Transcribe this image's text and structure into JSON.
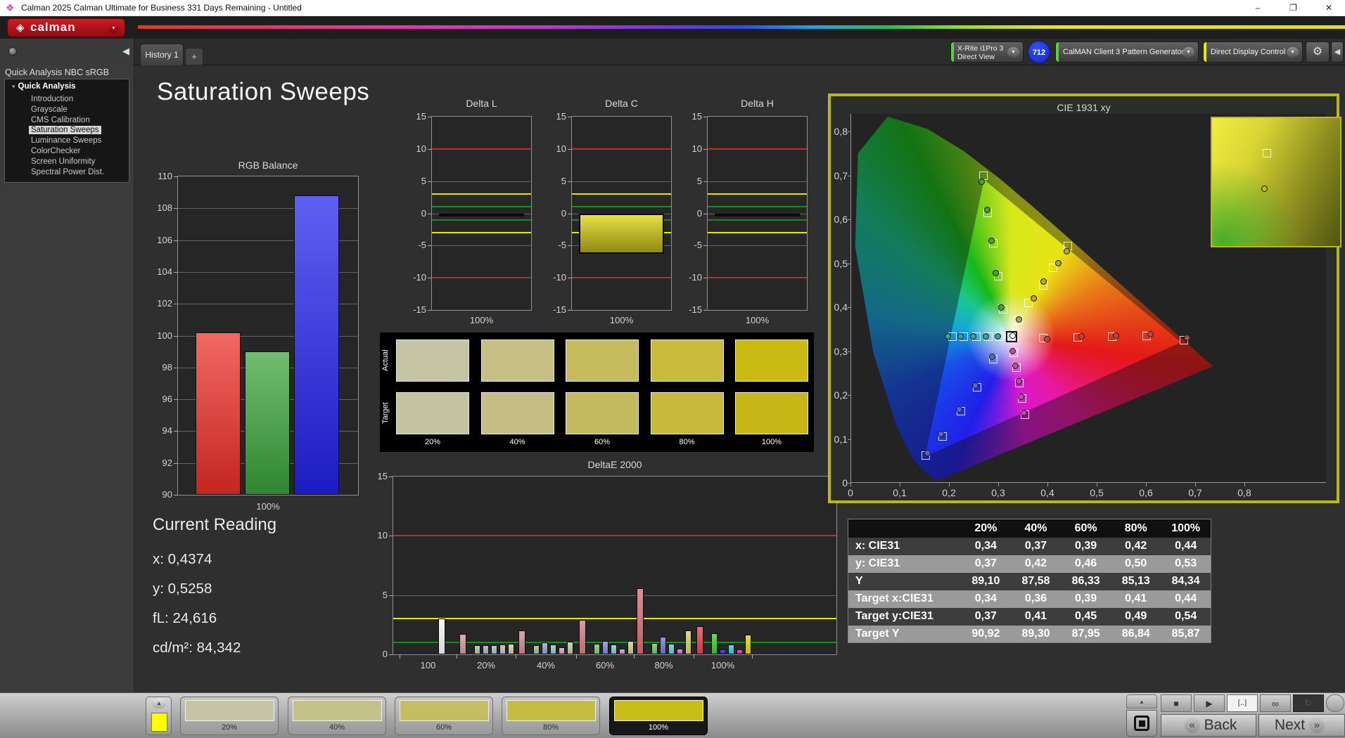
{
  "titlebar": {
    "title": "Calman 2025 Calman Ultimate for Business 331 Days Remaining  - Untitled",
    "minimize": "–",
    "maximize": "❐",
    "close": "✕"
  },
  "appbar": {
    "logo": "calman"
  },
  "icons": {
    "app": "❖",
    "logo_diamond": "◈",
    "dropdown": "▼",
    "collapse_left": "◀",
    "add": "+",
    "gear": "⚙",
    "tree_expand": "▾",
    "up": "▲",
    "play": "▶",
    "stop": "■",
    "pattern_window": "[‥]",
    "infinity": "∞",
    "repeat": "↻",
    "back_chev": "«",
    "next_chev": "»"
  },
  "toolbar": {
    "history_tab": "History 1",
    "meter_line1": "X-Rite i1Pro 3",
    "meter_line2": "Direct View",
    "meter_badge": "712",
    "pattern_source": "CalMAN Client 3 Pattern Generator",
    "display_control": "Direct Display Control"
  },
  "sidebar": {
    "workflow_title": "Quick Analysis NBC sRGB",
    "root": "Quick Analysis",
    "items": [
      "Introduction",
      "Grayscale",
      "CMS Calibration",
      "Saturation Sweeps",
      "Luminance Sweeps",
      "ColorChecker",
      "Screen Uniformity",
      "Spectral Power Dist."
    ],
    "selected_index": 3
  },
  "main": {
    "page_title": "Saturation Sweeps"
  },
  "current_reading": {
    "title": "Current Reading",
    "lines": [
      "x: 0,4374",
      "y: 0,5258",
      "fL: 24,616",
      "cd/m²: 84,342"
    ]
  },
  "chart_data": [
    {
      "id": "rgb_balance",
      "type": "bar",
      "title": "RGB Balance",
      "categories": [
        "Red",
        "Green",
        "Blue"
      ],
      "values": [
        100.2,
        99.0,
        108.8
      ],
      "colors": [
        "#ee2e28",
        "#3aa43a",
        "#2222ee"
      ],
      "ylim": [
        90,
        110
      ],
      "ytick_step": 2,
      "xlabel": "100%"
    },
    {
      "id": "delta_l",
      "type": "bar",
      "title": "Delta L",
      "categories": [
        "100%"
      ],
      "values": [
        -0.5
      ],
      "ylim": [
        -15,
        15
      ],
      "yticks": [
        15,
        10,
        5,
        0,
        -5,
        -10,
        -15
      ],
      "ref_lines": [
        {
          "v": 10,
          "c": "red"
        },
        {
          "v": 3,
          "c": "yellow"
        },
        {
          "v": 1,
          "c": "green"
        },
        {
          "v": -1,
          "c": "green"
        },
        {
          "v": -3,
          "c": "yellow"
        },
        {
          "v": -10,
          "c": "red"
        }
      ],
      "xlabel": "100%"
    },
    {
      "id": "delta_c",
      "type": "bar",
      "title": "Delta C",
      "categories": [
        "100%"
      ],
      "values": [
        -6.3
      ],
      "ylim": [
        -15,
        15
      ],
      "yticks": [
        15,
        10,
        5,
        0,
        -5,
        -10,
        -15
      ],
      "ref_lines": [
        {
          "v": 10,
          "c": "red"
        },
        {
          "v": 3,
          "c": "yellow"
        },
        {
          "v": 1,
          "c": "green"
        },
        {
          "v": -1,
          "c": "green"
        },
        {
          "v": -3,
          "c": "yellow"
        },
        {
          "v": -10,
          "c": "red"
        }
      ],
      "xlabel": "100%"
    },
    {
      "id": "delta_h",
      "type": "bar",
      "title": "Delta H",
      "categories": [
        "100%"
      ],
      "values": [
        -0.5
      ],
      "ylim": [
        -15,
        15
      ],
      "yticks": [
        15,
        10,
        5,
        0,
        -5,
        -10,
        -15
      ],
      "ref_lines": [
        {
          "v": 10,
          "c": "red"
        },
        {
          "v": 3,
          "c": "yellow"
        },
        {
          "v": 1,
          "c": "green"
        },
        {
          "v": -1,
          "c": "green"
        },
        {
          "v": -3,
          "c": "yellow"
        },
        {
          "v": -10,
          "c": "red"
        }
      ],
      "xlabel": "100%"
    },
    {
      "id": "deltae2000",
      "type": "grouped-bar",
      "title": "DeltaE 2000",
      "ylim": [
        0,
        15
      ],
      "yticks": [
        15,
        10,
        5,
        0
      ],
      "ref_lines": [
        {
          "v": 10,
          "c": "red"
        },
        {
          "v": 3,
          "c": "yellow"
        },
        {
          "v": 1,
          "c": "green"
        }
      ],
      "groups": [
        {
          "label": "100",
          "colors": [
            "#f2f2f2"
          ],
          "values": [
            3.0
          ]
        },
        {
          "label": "20%",
          "colors": [
            "#c9969b",
            "#a6bf9b",
            "#a9a6c9",
            "#9fb9c9",
            "#c9b0c0",
            "#c9c4a6"
          ],
          "values": [
            1.7,
            0.8,
            0.75,
            0.8,
            0.85,
            0.9
          ]
        },
        {
          "label": "40%",
          "colors": [
            "#c9868d",
            "#93bd8a",
            "#9199cc",
            "#8fc2cc",
            "#cba4bb",
            "#b9c794"
          ],
          "values": [
            2.0,
            0.75,
            1.0,
            0.85,
            0.6,
            1.05
          ]
        },
        {
          "label": "60%",
          "colors": [
            "#cc7a81",
            "#85bd7b",
            "#8086cf",
            "#7fc6cf",
            "#cf8fc3",
            "#bfcc7f"
          ],
          "values": [
            2.9,
            0.9,
            1.1,
            0.85,
            0.5,
            1.15
          ]
        },
        {
          "label": "80%",
          "colors": [
            "#d16a71",
            "#6cc05e",
            "#6f73d4",
            "#63c9d4",
            "#d46cc5",
            "#d4cc52"
          ],
          "values": [
            5.6,
            0.95,
            1.5,
            0.9,
            0.45,
            2.0
          ]
        },
        {
          "label": "100%",
          "colors": [
            "#d9434c",
            "#3cc43a",
            "#2626d9",
            "#2accd9",
            "#d926cf",
            "#d9cc1f"
          ],
          "values": [
            2.35,
            1.8,
            0.4,
            0.85,
            0.4,
            1.65
          ]
        }
      ]
    },
    {
      "id": "cie1931",
      "type": "scatter",
      "title": "CIE 1931 xy",
      "xlim": [
        0,
        0.8
      ],
      "ylim": [
        0,
        0.8
      ],
      "xtick_labels": [
        "0",
        "0,1",
        "0,2",
        "0,3",
        "0,4",
        "0,5",
        "0,6",
        "0,7",
        "0,8"
      ],
      "ytick_labels": [
        "0",
        "0,1",
        "0,2",
        "0,3",
        "0,4",
        "0,5",
        "0,6",
        "0,7",
        "0,8"
      ],
      "gamut_triangle": {
        "red": [
          0.67,
          0.32
        ],
        "green": [
          0.27,
          0.69
        ],
        "blue": [
          0.15,
          0.06
        ]
      },
      "white_point": {
        "target": [
          0.325,
          0.333
        ],
        "measured": [
          0.328,
          0.335
        ]
      },
      "sweeps": [
        {
          "name": "red",
          "color": "#b84848",
          "targets": [
            [
              0.39,
              0.33
            ],
            [
              0.46,
              0.332
            ],
            [
              0.53,
              0.333
            ],
            [
              0.6,
              0.335
            ],
            [
              0.675,
              0.325
            ]
          ],
          "measured": [
            [
              0.398,
              0.328
            ],
            [
              0.468,
              0.334
            ],
            [
              0.538,
              0.336
            ],
            [
              0.608,
              0.338
            ],
            [
              0.682,
              0.33
            ]
          ]
        },
        {
          "name": "green",
          "color": "#4a9e4a",
          "targets": [
            [
              0.309,
              0.396
            ],
            [
              0.298,
              0.47
            ],
            [
              0.288,
              0.545
            ],
            [
              0.277,
              0.615
            ],
            [
              0.268,
              0.7
            ]
          ],
          "measured": [
            [
              0.305,
              0.4
            ],
            [
              0.294,
              0.478
            ],
            [
              0.285,
              0.552
            ],
            [
              0.276,
              0.622
            ],
            [
              0.265,
              0.685
            ]
          ]
        },
        {
          "name": "blue",
          "color": "#5868b8",
          "targets": [
            [
              0.289,
              0.281
            ],
            [
              0.256,
              0.218
            ],
            [
              0.223,
              0.163
            ],
            [
              0.186,
              0.105
            ],
            [
              0.152,
              0.063
            ]
          ],
          "measured": [
            [
              0.286,
              0.287
            ],
            [
              0.252,
              0.222
            ],
            [
              0.219,
              0.168
            ],
            [
              0.182,
              0.112
            ],
            [
              0.155,
              0.068
            ]
          ]
        },
        {
          "name": "cyan",
          "color": "#3aa0a0",
          "targets": [
            [
              0.302,
              0.333
            ],
            [
              0.278,
              0.333
            ],
            [
              0.254,
              0.333
            ],
            [
              0.229,
              0.333
            ],
            [
              0.205,
              0.333
            ]
          ],
          "measured": [
            [
              0.298,
              0.334
            ],
            [
              0.273,
              0.334
            ],
            [
              0.248,
              0.334
            ],
            [
              0.222,
              0.334
            ],
            [
              0.197,
              0.334
            ]
          ]
        },
        {
          "name": "magenta",
          "color": "#a85898",
          "targets": [
            [
              0.33,
              0.296
            ],
            [
              0.336,
              0.262
            ],
            [
              0.341,
              0.228
            ],
            [
              0.347,
              0.192
            ],
            [
              0.353,
              0.156
            ]
          ],
          "measured": [
            [
              0.328,
              0.3
            ],
            [
              0.334,
              0.266
            ],
            [
              0.34,
              0.232
            ],
            [
              0.345,
              0.196
            ],
            [
              0.351,
              0.16
            ]
          ]
        },
        {
          "name": "yellow",
          "color": "#b0a848",
          "targets": [
            [
              0.34,
              0.37
            ],
            [
              0.36,
              0.41
            ],
            [
              0.39,
              0.45
            ],
            [
              0.41,
              0.49
            ],
            [
              0.44,
              0.54
            ]
          ],
          "measured": [
            [
              0.34,
              0.372
            ],
            [
              0.37,
              0.42
            ],
            [
              0.39,
              0.458
            ],
            [
              0.42,
              0.5
            ],
            [
              0.438,
              0.528
            ]
          ]
        }
      ]
    }
  ],
  "swatch_grid": {
    "row_labels": [
      "Actual",
      "Target"
    ],
    "col_labels": [
      "20%",
      "40%",
      "60%",
      "80%",
      "100%"
    ],
    "actual": [
      "#c5c4a4",
      "#c6c084",
      "#c6bc5d",
      "#c9bc3a",
      "#c9bb14"
    ],
    "target": [
      "#c4c3a2",
      "#c4be85",
      "#c4ba5e",
      "#c6b93c",
      "#c6b716"
    ]
  },
  "table": {
    "headers": [
      "",
      "20%",
      "40%",
      "60%",
      "80%",
      "100%"
    ],
    "rows": [
      [
        "x: CIE31",
        "0,34",
        "0,37",
        "0,39",
        "0,42",
        "0,44"
      ],
      [
        "y: CIE31",
        "0,37",
        "0,42",
        "0,46",
        "0,50",
        "0,53"
      ],
      [
        "Y",
        "89,10",
        "87,58",
        "86,33",
        "85,13",
        "84,34"
      ],
      [
        "Target x:CIE31",
        "0,34",
        "0,36",
        "0,39",
        "0,41",
        "0,44"
      ],
      [
        "Target y:CIE31",
        "0,37",
        "0,41",
        "0,45",
        "0,49",
        "0,54"
      ],
      [
        "Target Y",
        "90,92",
        "89,30",
        "87,95",
        "86,84",
        "85,87"
      ]
    ]
  },
  "bottom_bar": {
    "current_patch_color": "#ffff00",
    "patches": [
      {
        "label": "20%",
        "color": "#c6c4a5"
      },
      {
        "label": "40%",
        "color": "#c5c287"
      },
      {
        "label": "60%",
        "color": "#c3be62"
      },
      {
        "label": "80%",
        "color": "#c5bd42"
      },
      {
        "label": "100%",
        "color": "#c9bd17"
      }
    ],
    "selected": "100%"
  },
  "nav": {
    "back": "Back",
    "next": "Next"
  }
}
